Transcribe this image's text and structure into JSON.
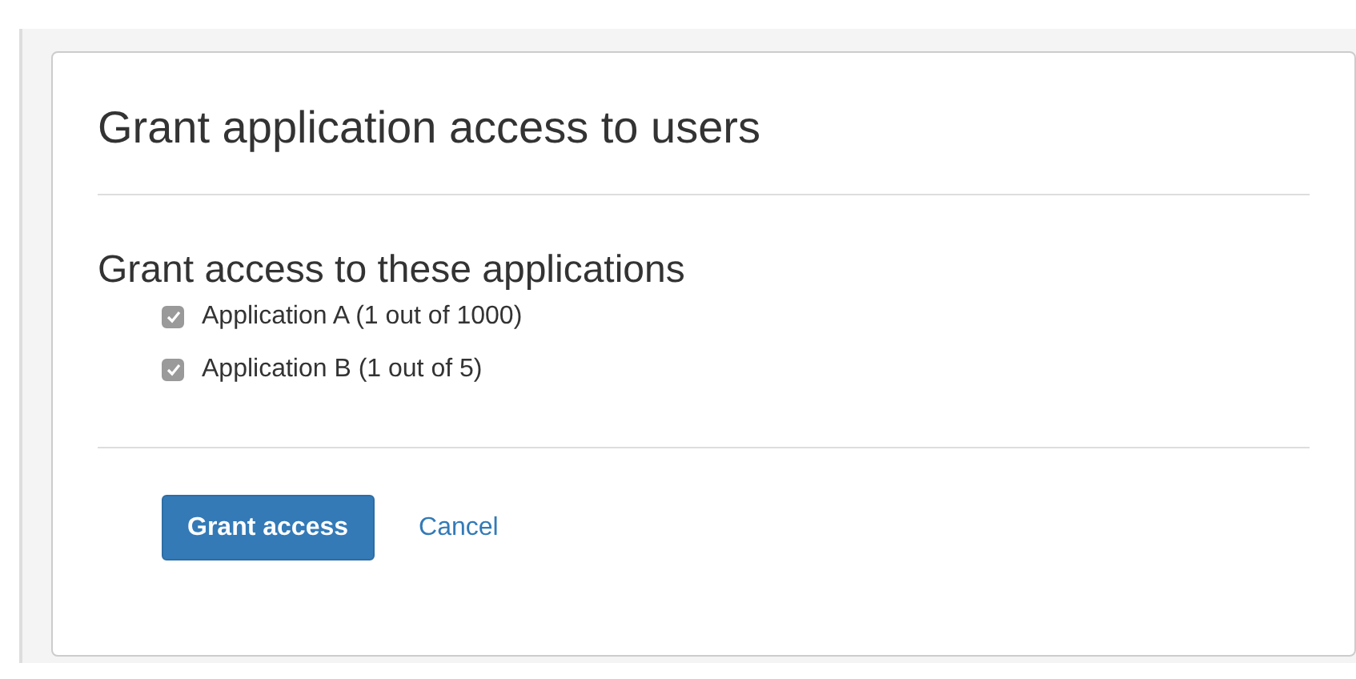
{
  "dialog": {
    "title": "Grant application access to users",
    "section_title": "Grant access to these applications",
    "applications": [
      {
        "label": "Application A (1 out of 1000)",
        "checked": true
      },
      {
        "label": "Application B (1 out of 5)",
        "checked": true
      }
    ],
    "buttons": [
      {
        "label": "Grant access",
        "kind": "primary"
      },
      {
        "label": "Cancel",
        "kind": "link"
      }
    ]
  }
}
